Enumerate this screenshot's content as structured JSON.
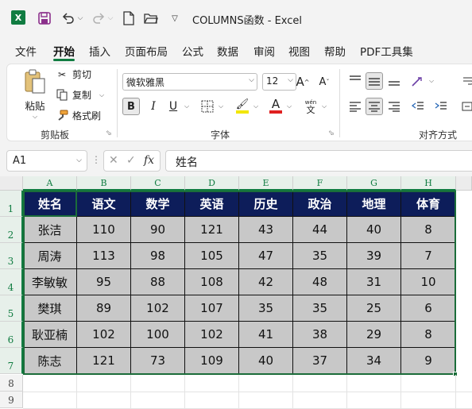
{
  "titlebar": {
    "logo": "X",
    "title": "COLUMNS函数  -  Excel"
  },
  "menu": [
    "文件",
    "开始",
    "插入",
    "页面布局",
    "公式",
    "数据",
    "审阅",
    "视图",
    "帮助",
    "PDF工具集"
  ],
  "ribbon": {
    "clipboard": {
      "paste": "粘贴",
      "cut": "剪切",
      "copy": "复制",
      "format_painter": "格式刷",
      "label": "剪贴板"
    },
    "font": {
      "font_name": "微软雅黑",
      "font_size": "12",
      "bold": "B",
      "italic": "I",
      "underline": "U",
      "phonetic_top": "wén",
      "phonetic_bottom": "文",
      "font_color_letter": "A",
      "label": "字体"
    },
    "alignment": {
      "label": "对齐方式"
    }
  },
  "formula_bar": {
    "name_box": "A1",
    "fx": "fx",
    "formula": "姓名"
  },
  "colors": {
    "excel_green": "#107c41",
    "header_fill": "#0d1d5a",
    "body_fill": "#c8c8c8",
    "font_color_bar": "#e02020",
    "highlight_bar": "#f2e600"
  },
  "sheet": {
    "col_headers": [
      "A",
      "B",
      "C",
      "D",
      "E",
      "F",
      "G",
      "H"
    ],
    "row_headers": [
      "1",
      "2",
      "3",
      "4",
      "5",
      "6",
      "7",
      "8",
      "9"
    ],
    "header": [
      "姓名",
      "语文",
      "数学",
      "英语",
      "历史",
      "政治",
      "地理",
      "体育"
    ],
    "rows": [
      [
        "张洁",
        "110",
        "90",
        "121",
        "43",
        "44",
        "40",
        "8"
      ],
      [
        "周涛",
        "113",
        "98",
        "105",
        "47",
        "35",
        "39",
        "7"
      ],
      [
        "李敏敏",
        "95",
        "88",
        "108",
        "42",
        "48",
        "31",
        "10"
      ],
      [
        "樊琪",
        "89",
        "102",
        "107",
        "35",
        "35",
        "25",
        "6"
      ],
      [
        "耿亚楠",
        "102",
        "100",
        "102",
        "41",
        "38",
        "29",
        "8"
      ],
      [
        "陈志",
        "121",
        "73",
        "109",
        "40",
        "37",
        "34",
        "9"
      ]
    ]
  }
}
